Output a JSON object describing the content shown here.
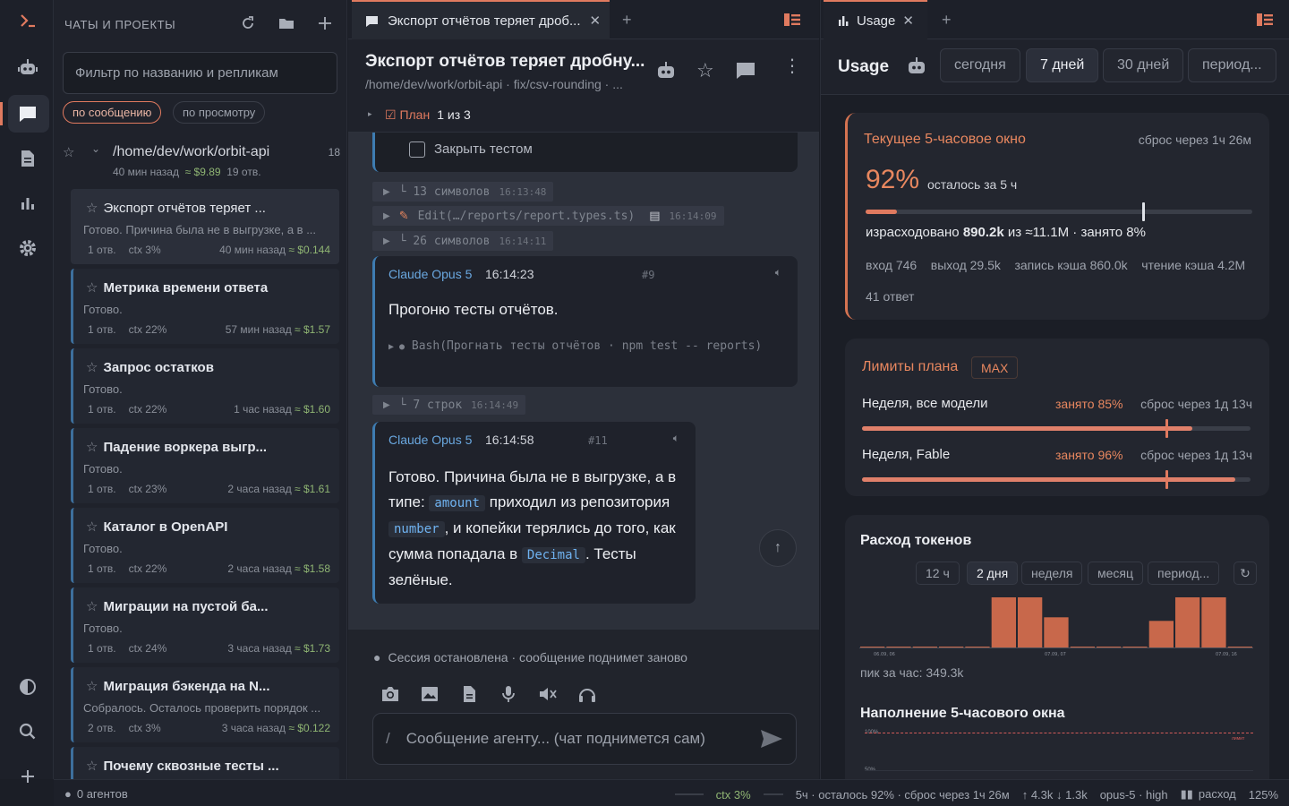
{
  "sidebar": {
    "header": "ЧАТЫ И ПРОЕКТЫ",
    "filter_placeholder": "Фильтр по названию и репликам",
    "sort_by_message": "по сообщению",
    "sort_by_view": "по просмотру",
    "project": {
      "path": "/home/dev/work/orbit-api",
      "count": "18",
      "age": "40 мин назад",
      "cost": "≈ $9.89",
      "replies": "19 отв."
    },
    "chats": [
      {
        "title": "Экспорт отчётов теряет ...",
        "summary": "Готово. Причина была не в выгрузке, а в ...",
        "replies": "1 отв.",
        "ctx": "ctx 3%",
        "age": "40 мин назад",
        "cost": "≈ $0.144"
      },
      {
        "title": "Метрика времени ответа",
        "summary": "Готово.",
        "replies": "1 отв.",
        "ctx": "ctx 22%",
        "age": "57 мин назад",
        "cost": "≈ $1.57"
      },
      {
        "title": "Запрос остатков",
        "summary": "Готово.",
        "replies": "1 отв.",
        "ctx": "ctx 22%",
        "age": "1 час назад",
        "cost": "≈ $1.60"
      },
      {
        "title": "Падение воркера выгр...",
        "summary": "Готово.",
        "replies": "1 отв.",
        "ctx": "ctx 23%",
        "age": "2 часа назад",
        "cost": "≈ $1.61"
      },
      {
        "title": "Каталог в OpenAPI",
        "summary": "Готово.",
        "replies": "1 отв.",
        "ctx": "ctx 22%",
        "age": "2 часа назад",
        "cost": "≈ $1.58"
      },
      {
        "title": "Миграции на пустой ба...",
        "summary": "Готово.",
        "replies": "1 отв.",
        "ctx": "ctx 24%",
        "age": "3 часа назад",
        "cost": "≈ $1.73"
      },
      {
        "title": "Миграция бэкенда на N...",
        "summary": "Собралось. Осталось проверить порядок ...",
        "replies": "2 отв.",
        "ctx": "ctx 3%",
        "age": "3 часа назад",
        "cost": "≈ $0.122"
      },
      {
        "title": "Почему сквозные тесты ...",
        "summary": "",
        "replies": "",
        "ctx": "",
        "age": "",
        "cost": ""
      }
    ]
  },
  "chat": {
    "tab_title": "Экспорт отчётов теряет дроб...",
    "title": "Экспорт отчётов теряет дробну...",
    "path": "/home/dev/work/orbit-api · fix/csv-rounding · ...",
    "plan_label": "☑ План",
    "plan_progress": "1 из 3",
    "todo_item": "Закрыть тестом",
    "tool_rows": [
      {
        "text": "└ 13 символов",
        "time": "16:13:48"
      },
      {
        "text": "Edit(…/reports/report.types.ts)",
        "time": "16:14:09"
      },
      {
        "text": "└ 26 символов",
        "time": "16:14:11"
      },
      {
        "text": "└ 7 строк",
        "time": "16:14:49"
      }
    ],
    "messages": [
      {
        "author": "Claude Opus 5",
        "time": "16:14:23",
        "index": "#9",
        "text": "Прогоню тесты отчётов.",
        "bash": "Bash(Прогнать тесты отчётов · npm test -- reports)"
      },
      {
        "author": "Claude Opus 5",
        "time": "16:14:58",
        "index": "#11",
        "p1": "Готово. Причина была не в выгрузке, а в типе:",
        "code1": "amount",
        "p2": "приходил из репозитория",
        "code2": "number",
        "p3": ", и копейки терялись до того, как сумма попадала в",
        "code3": "Decimal",
        "p4": ". Тесты зелёные."
      }
    ],
    "session_status": "Сессия остановлена · сообщение поднимет заново",
    "composer_prefix": "/",
    "composer_placeholder": "Сообщение агенту... (чат поднимется сам)"
  },
  "usage": {
    "tab_title": "Usage",
    "title": "Usage",
    "ranges": [
      "сегодня",
      "7 дней",
      "30 дней",
      "период..."
    ],
    "window": {
      "title": "Текущее 5-часовое окно",
      "reset": "сброс через 1ч 26м",
      "percent": "92%",
      "left_label": "осталось за 5 ч",
      "used_fraction": 0.08,
      "spent_prefix": "израсходовано",
      "spent": "890.2k",
      "spent_suffix": "из ≈11.1M · занято 8%",
      "in": "вход 746",
      "out": "выход 29.5k",
      "cache_write": "запись кэша 860.0k",
      "cache_read": "чтение кэша 4.2M",
      "answers": "41 ответ"
    },
    "limits": {
      "title": "Лимиты плана",
      "badge": "MAX",
      "rows": [
        {
          "name": "Неделя, все модели",
          "used": "занято 85%",
          "reset": "сброс через 1д 13ч",
          "fraction": 0.85
        },
        {
          "name": "Неделя, Fable",
          "used": "занято 96%",
          "reset": "сброс через 1д 13ч",
          "fraction": 0.96
        }
      ]
    },
    "tokens": {
      "title": "Расход токенов",
      "segments": [
        "12 ч",
        "2 дня",
        "неделя",
        "месяц",
        "период..."
      ],
      "peak": "пик за час: 349.3k",
      "x_labels": [
        "06.09, 06",
        "07.09, 07",
        "07.09, 16"
      ]
    },
    "fill_title": "Наполнение 5-часового окна",
    "fill_y_labels": [
      "100%",
      "50%"
    ],
    "fill_limit_label": "лимит"
  },
  "footer": {
    "agents": "0 агентов",
    "ctx": "ctx 3%",
    "window": "5ч · осталось 92% · сброс через 1ч 26м",
    "io": "↑ 4.3k ↓ 1.3k",
    "model": "opus-5 · high",
    "spend": "расход",
    "zoom": "125%"
  },
  "chart_data": {
    "type": "bar",
    "title": "Расход токенов",
    "x_ticks": [
      "06.09, 06",
      "07.09, 07",
      "07.09, 16"
    ],
    "values": [
      2,
      2,
      2,
      2,
      4,
      349,
      349,
      210,
      4,
      4,
      4,
      185,
      349,
      349,
      2
    ],
    "peak_label": "пик за час: 349.3k"
  }
}
